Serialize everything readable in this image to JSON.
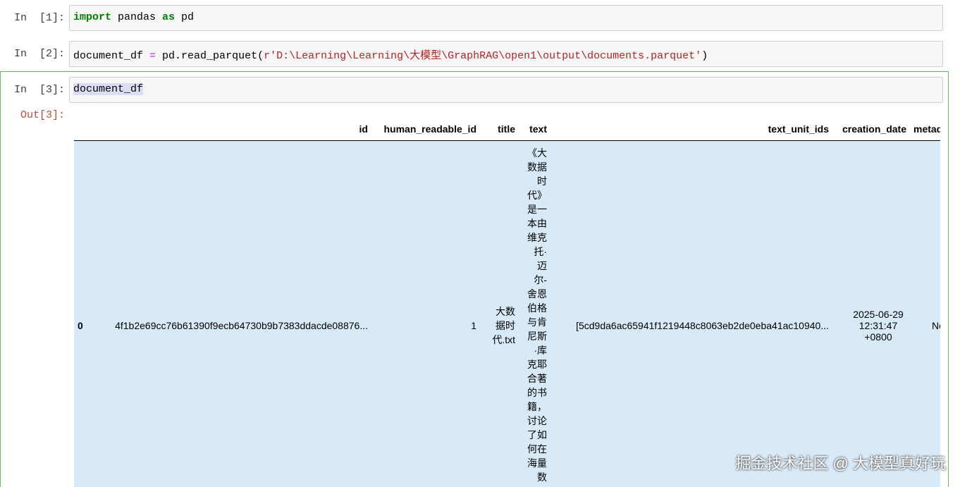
{
  "cells": [
    {
      "prompt": "In  [1]:",
      "tokens": [
        {
          "t": "import",
          "c": "kw"
        },
        {
          "t": " pandas ",
          "c": ""
        },
        {
          "t": "as",
          "c": "kw"
        },
        {
          "t": " pd",
          "c": ""
        }
      ]
    },
    {
      "prompt": "In  [2]:",
      "tokens": [
        {
          "t": "document_df ",
          "c": ""
        },
        {
          "t": "=",
          "c": "op"
        },
        {
          "t": " pd.read_parquet(",
          "c": ""
        },
        {
          "t": "r'D:\\Learning\\Learning\\大模型\\GraphRAG\\open1\\output\\documents.parquet'",
          "c": "str"
        },
        {
          "t": ")",
          "c": ""
        }
      ]
    },
    {
      "prompt": "In  [3]:",
      "tokens": [
        {
          "t": "document_df",
          "c": "sel"
        }
      ]
    }
  ],
  "output_prompt": "Out[3]:",
  "table": {
    "columns": [
      "",
      "id",
      "human_readable_id",
      "title",
      "text",
      "text_unit_ids",
      "creation_date",
      "metada"
    ],
    "row": {
      "index": "0",
      "id": "4f1b2e69cc76b61390f9ecb64730b9b7383ddacde08876...",
      "human_readable_id": "1",
      "title": "大数据时代.txt",
      "text": "《大数据时代》是一本由维克托·迈尔-舍恩伯格与肯尼斯·库克耶合著的书籍，讨论了如何在海量数",
      "text_unit_ids": "[5cd9da6ac65941f1219448c8063eb2de0eba41ac10940...",
      "creation_date": "2025-06-29 12:31:47 +0800",
      "metadata": "No"
    }
  },
  "watermark": "掘金技术社区 @ 大模型真好玩"
}
